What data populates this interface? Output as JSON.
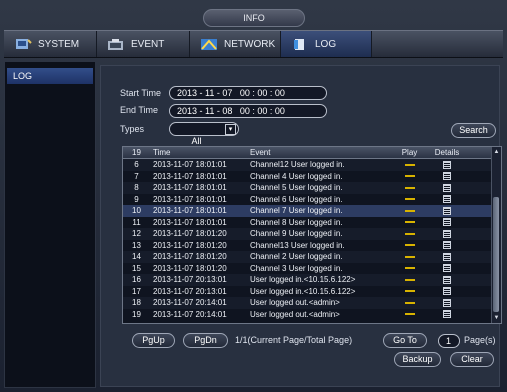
{
  "header": {
    "info_label": "INFO"
  },
  "nav": [
    {
      "label": "SYSTEM",
      "icon": "system-icon"
    },
    {
      "label": "EVENT",
      "icon": "event-icon"
    },
    {
      "label": "NETWORK",
      "icon": "network-icon"
    },
    {
      "label": "LOG",
      "icon": "log-icon",
      "active": true
    }
  ],
  "sidebar": {
    "items": [
      {
        "label": "LOG"
      }
    ]
  },
  "filters": {
    "start_label": "Start Time",
    "start_value": "2013 - 11 - 07   00 : 00 : 00",
    "end_label": "End Time",
    "end_value": "2013 - 11 - 08   00 : 00 : 00",
    "types_label": "Types",
    "types_value": "All",
    "search_label": "Search"
  },
  "table": {
    "headers": {
      "no": "19",
      "time": "Time",
      "event": "Event",
      "play": "Play",
      "details": "Details"
    },
    "rows": [
      {
        "no": "6",
        "time": "2013-11-07 18:01:01",
        "event": "Channel12  User logged in."
      },
      {
        "no": "7",
        "time": "2013-11-07 18:01:01",
        "event": "Channel 4  User logged in."
      },
      {
        "no": "8",
        "time": "2013-11-07 18:01:01",
        "event": "Channel 5  User logged in."
      },
      {
        "no": "9",
        "time": "2013-11-07 18:01:01",
        "event": "Channel 6  User logged in."
      },
      {
        "no": "10",
        "time": "2013-11-07 18:01:01",
        "event": "Channel 7  User logged in."
      },
      {
        "no": "11",
        "time": "2013-11-07 18:01:01",
        "event": "Channel 8  User logged in."
      },
      {
        "no": "12",
        "time": "2013-11-07 18:01:20",
        "event": "Channel 9  User logged in."
      },
      {
        "no": "13",
        "time": "2013-11-07 18:01:20",
        "event": "Channel13  User logged in."
      },
      {
        "no": "14",
        "time": "2013-11-07 18:01:20",
        "event": "Channel 2  User logged in."
      },
      {
        "no": "15",
        "time": "2013-11-07 18:01:20",
        "event": "Channel 3  User logged in."
      },
      {
        "no": "16",
        "time": "2013-11-07 20:13:01",
        "event": "User logged in.<10.15.6.122>"
      },
      {
        "no": "17",
        "time": "2013-11-07 20:13:01",
        "event": "User logged in.<10.15.6.122>"
      },
      {
        "no": "18",
        "time": "2013-11-07 20:14:01",
        "event": "User logged out.<admin>"
      },
      {
        "no": "19",
        "time": "2013-11-07 20:14:01",
        "event": "User logged out.<admin>"
      }
    ]
  },
  "pager": {
    "pgup_label": "PgUp",
    "pgdn_label": "PgDn",
    "page_info": "1/1(Current Page/Total Page)",
    "goto_label": "Go To",
    "page_value": "1",
    "pages_label": "Page(s)"
  },
  "actions": {
    "backup_label": "Backup",
    "clear_label": "Clear"
  },
  "colors": {
    "accent": "#2d3c62",
    "play_mark": "#d8b300"
  }
}
